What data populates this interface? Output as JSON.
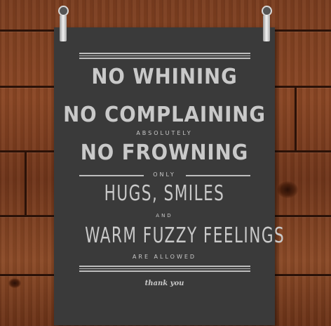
{
  "poster": {
    "line1": "NO WHINING",
    "line2": "NO COMPLAINING",
    "line3": "ABSOLUTELY",
    "line4": "NO FROWNING",
    "line5": "ONLY",
    "line6": "HUGS, SMILES",
    "line7": "AND",
    "line8": "WARM FUZZY FEELINGS",
    "line9": "ARE ALLOWED",
    "signoff": "thank you"
  },
  "colors": {
    "poster_bg": "#3a3a3a",
    "text": "#c9c9c9",
    "wood": "#7a3d1f"
  }
}
